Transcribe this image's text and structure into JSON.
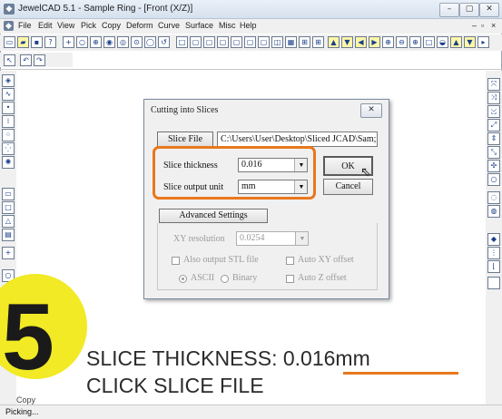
{
  "window": {
    "title": "JewelCAD 5.1 - Sample Ring - [Front (X/Z)]",
    "controls": [
      "–",
      "▢",
      "✕"
    ]
  },
  "menu": [
    "File",
    "Edit",
    "View",
    "Pick",
    "Copy",
    "Deform",
    "Curve",
    "Surface",
    "Misc",
    "Help"
  ],
  "dialog": {
    "title": "Cutting into Slices",
    "close_label": "✕",
    "slice_file_button": "Slice File",
    "slice_file_path": "C:\\Users\\User\\Desktop\\Sliced JCAD\\Sam;",
    "thickness_label": "Slice thickness",
    "thickness_value": "0.016",
    "unit_label": "Slice output unit",
    "unit_value": "mm",
    "ok_label": "OK",
    "cancel_label": "Cancel",
    "advanced_button": "Advanced Settings",
    "xy_resolution_label": "XY resolution",
    "xy_resolution_value": "0.0254",
    "also_stl_label": "Also output STL file",
    "auto_xy_label": "Auto XY offset",
    "ascii_label": "ASCII",
    "binary_label": "Binary",
    "auto_z_label": "Auto Z offset"
  },
  "overlay": {
    "step_number": "5",
    "line1_prefix": "SLICE THICKNESS: ",
    "line1_value": "0.016mm",
    "line2": "CLICK SLICE FILE",
    "accent_color": "#e8781e",
    "badge_color": "#f1ea24"
  },
  "status": {
    "text": "Picking...",
    "side_text": "Copy"
  }
}
